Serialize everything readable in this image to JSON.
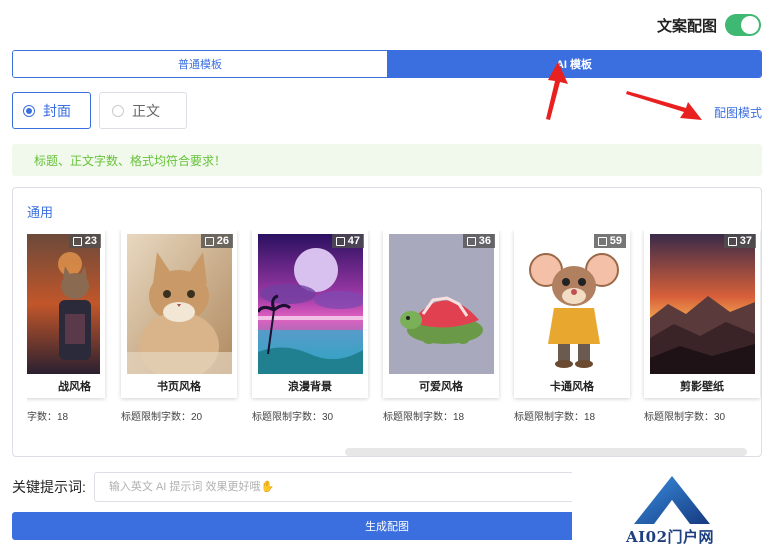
{
  "header": {
    "copy_image_label": "文案配图",
    "toggle_on": true
  },
  "tabs": [
    {
      "label": "普通模板",
      "active": false
    },
    {
      "label": "AI 模板",
      "active": true
    }
  ],
  "radios": [
    {
      "label": "封面",
      "selected": true
    },
    {
      "label": "正文",
      "selected": false
    }
  ],
  "mode_link": "配图模式",
  "alert": {
    "text": "标题、正文字数、格式均符合要求！"
  },
  "panel": {
    "title": "通用",
    "cards": [
      {
        "name": "战风格",
        "count": "23",
        "limit": "字数：18"
      },
      {
        "name": "书页风格",
        "count": "26",
        "limit": "标题限制字数：20"
      },
      {
        "name": "浪漫背景",
        "count": "47",
        "limit": "标题限制字数：30"
      },
      {
        "name": "可爱风格",
        "count": "36",
        "limit": "标题限制字数：18"
      },
      {
        "name": "卡通风格",
        "count": "59",
        "limit": "标题限制字数：18"
      },
      {
        "name": "剪影壁纸",
        "count": "37",
        "limit": "标题限制字数：30"
      }
    ]
  },
  "keyword": {
    "label": "关键提示词:",
    "placeholder": "输入英文 AI 提示词 效果更好哦✋"
  },
  "generate_button": "生成配图",
  "watermark": {
    "text": "AI02门户网"
  },
  "colors": {
    "accent": "#3b6fe0",
    "success": "#67c23a",
    "toggle": "#3eb873",
    "arrow": "#e82020"
  }
}
